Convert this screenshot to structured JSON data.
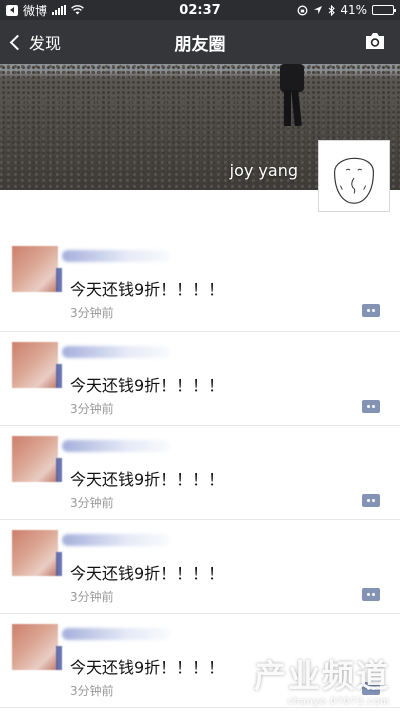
{
  "status_bar": {
    "back_app": "微博",
    "carrier_signal": "full",
    "time": "02:37",
    "battery_percent": "41%",
    "battery_level": 0.41
  },
  "nav": {
    "back_label": "发现",
    "title": "朋友圈"
  },
  "cover": {
    "username": "joy yang"
  },
  "posts": [
    {
      "text": "今天还钱9折！！！！",
      "time": "3分钟前"
    },
    {
      "text": "今天还钱9折！！！！",
      "time": "3分钟前"
    },
    {
      "text": "今天还钱9折！！！！",
      "time": "3分钟前"
    },
    {
      "text": "今天还钱9折！！！！",
      "time": "3分钟前"
    },
    {
      "text": "今天还钱9折！！！！",
      "time": "3分钟前"
    }
  ],
  "watermark": {
    "main": "产业频道",
    "sub": "chanye.07073.com"
  },
  "colors": {
    "nav_bg": "#242529",
    "comment_icon": "#8393b6",
    "time_text": "#9a9a9a"
  }
}
